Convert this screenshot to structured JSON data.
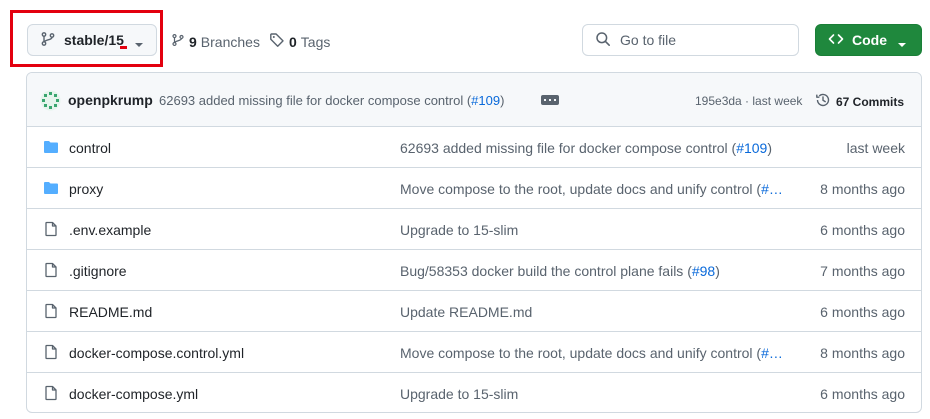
{
  "toolbar": {
    "branch_label": "stable/15",
    "branches_count": "9",
    "branches_label": "Branches",
    "tags_count": "0",
    "tags_label": "Tags",
    "search_placeholder": "Go to file",
    "code_label": "Code"
  },
  "latest_commit": {
    "author": "openpkrump",
    "message": "62693 added missing file for docker compose control (",
    "pr": "#109",
    "message_end": ")",
    "sha": "195e3da",
    "sep": " · ",
    "time": "last week",
    "commits": "67 Commits"
  },
  "files": [
    {
      "type": "folder",
      "name": "control",
      "msg": "62693 added missing file for docker compose control (",
      "pr": "#109",
      "msg_end": ")",
      "age": "last week"
    },
    {
      "type": "folder",
      "name": "proxy",
      "msg": "Move compose to the root, update docs and unify control (",
      "pr": "#…",
      "msg_end": "",
      "age": "8 months ago"
    },
    {
      "type": "file",
      "name": ".env.example",
      "msg": "Upgrade to 15-slim",
      "pr": "",
      "msg_end": "",
      "age": "6 months ago"
    },
    {
      "type": "file",
      "name": ".gitignore",
      "msg": "Bug/58353 docker build the control plane fails (",
      "pr": "#98",
      "msg_end": ")",
      "age": "7 months ago"
    },
    {
      "type": "file",
      "name": "README.md",
      "msg": "Update README.md",
      "pr": "",
      "msg_end": "",
      "age": "6 months ago"
    },
    {
      "type": "file",
      "name": "docker-compose.control.yml",
      "msg": "Move compose to the root, update docs and unify control (",
      "pr": "#…",
      "msg_end": "",
      "age": "8 months ago"
    },
    {
      "type": "file",
      "name": "docker-compose.yml",
      "msg": "Upgrade to 15-slim",
      "pr": "",
      "msg_end": "",
      "age": "6 months ago"
    }
  ],
  "colors": {
    "accent_green": "#1f883d",
    "link_blue": "#0969da",
    "folder_blue": "#54aeff",
    "highlight_red": "#e3000f"
  }
}
